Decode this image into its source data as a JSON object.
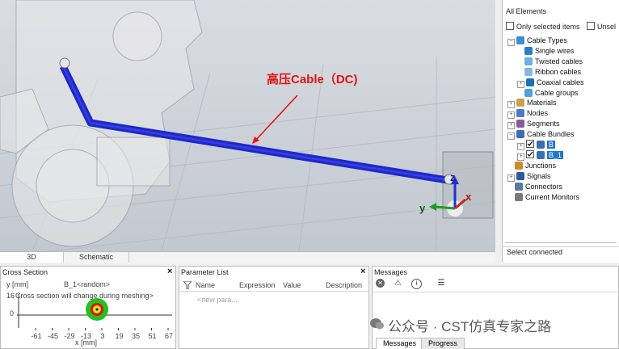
{
  "viewport": {
    "annotation": "高压Cable（DC)",
    "axes": {
      "z": "z",
      "y": "y",
      "x": "x"
    },
    "tabs": [
      "3D",
      "Schematic"
    ]
  },
  "tree": {
    "title": "All Elements",
    "only_selected": "Only selected items",
    "unselect": "Unsel",
    "items": [
      {
        "label": "Cable Types",
        "indent": 0,
        "exp": "−",
        "icon": "cable-types-icon",
        "color": "#3c8dd4"
      },
      {
        "label": "Single wires",
        "indent": 1,
        "exp": "",
        "icon": "single-wire-icon",
        "color": "#2a7fc9"
      },
      {
        "label": "Twisted cables",
        "indent": 1,
        "exp": "",
        "icon": "twisted-cable-icon",
        "color": "#6bb0e6"
      },
      {
        "label": "Ribbon cables",
        "indent": 1,
        "exp": "",
        "icon": "ribbon-cable-icon",
        "color": "#87b7e0"
      },
      {
        "label": "Coaxial cables",
        "indent": 1,
        "exp": "+",
        "icon": "coaxial-cable-icon",
        "color": "#1f6fb4"
      },
      {
        "label": "Cable groups",
        "indent": 1,
        "exp": "",
        "icon": "cable-group-icon",
        "color": "#4aa3df"
      },
      {
        "label": "Materials",
        "indent": 0,
        "exp": "+",
        "icon": "materials-icon",
        "color": "#c8a24a"
      },
      {
        "label": "Nodes",
        "indent": 0,
        "exp": "+",
        "icon": "nodes-icon",
        "color": "#4a7ac8"
      },
      {
        "label": "Segments",
        "indent": 0,
        "exp": "+",
        "icon": "segments-icon",
        "color": "#8a5a9a"
      },
      {
        "label": "Cable Bundles",
        "indent": 0,
        "exp": "−",
        "icon": "cable-bundles-icon",
        "color": "#3a6fb0"
      },
      {
        "label": "B",
        "indent": 1,
        "exp": "+",
        "icon": "bundle-icon",
        "color": "#3a6fb0",
        "checked": true,
        "selected": true
      },
      {
        "label": "B_1",
        "indent": 1,
        "exp": "+",
        "icon": "bundle-icon",
        "color": "#3a6fb0",
        "checked": true,
        "selected": true
      },
      {
        "label": "Junctions",
        "indent": 0,
        "exp": "",
        "icon": "junctions-icon",
        "color": "#d08a2a"
      },
      {
        "label": "Signals",
        "indent": 0,
        "exp": "+",
        "icon": "signals-icon",
        "color": "#2a5aa0"
      },
      {
        "label": "Connectors",
        "indent": 0,
        "exp": "",
        "icon": "connectors-icon",
        "color": "#5a7aa0"
      },
      {
        "label": "Current Monitors",
        "indent": 0,
        "exp": "",
        "icon": "current-monitor-icon",
        "color": "#7a7a7a"
      }
    ],
    "select_connected": "Select connected"
  },
  "cross_section": {
    "title": "Cross Section",
    "ylabel": "y [mm]",
    "bundle": "B_1<random>",
    "notice": "Cross section will change during meshing>",
    "y_ticks": [
      "16",
      "0"
    ],
    "x_ticks": [
      "-61",
      "-45",
      "-29",
      "-13",
      "3",
      "19",
      "35",
      "51",
      "67"
    ],
    "xlabel": "x [mm]"
  },
  "parameter_list": {
    "title": "Parameter List",
    "columns": [
      "Name",
      "Expression",
      "Value",
      "Description"
    ],
    "new_row": "<new para..."
  },
  "messages": {
    "title": "Messages",
    "tabs": [
      "Messages",
      "Progress"
    ]
  },
  "watermark": "公众号 · CST仿真专家之路",
  "colors": {
    "cable": "#1f27c8",
    "annotation_red": "#e01515",
    "selection": "#1e74d0"
  }
}
